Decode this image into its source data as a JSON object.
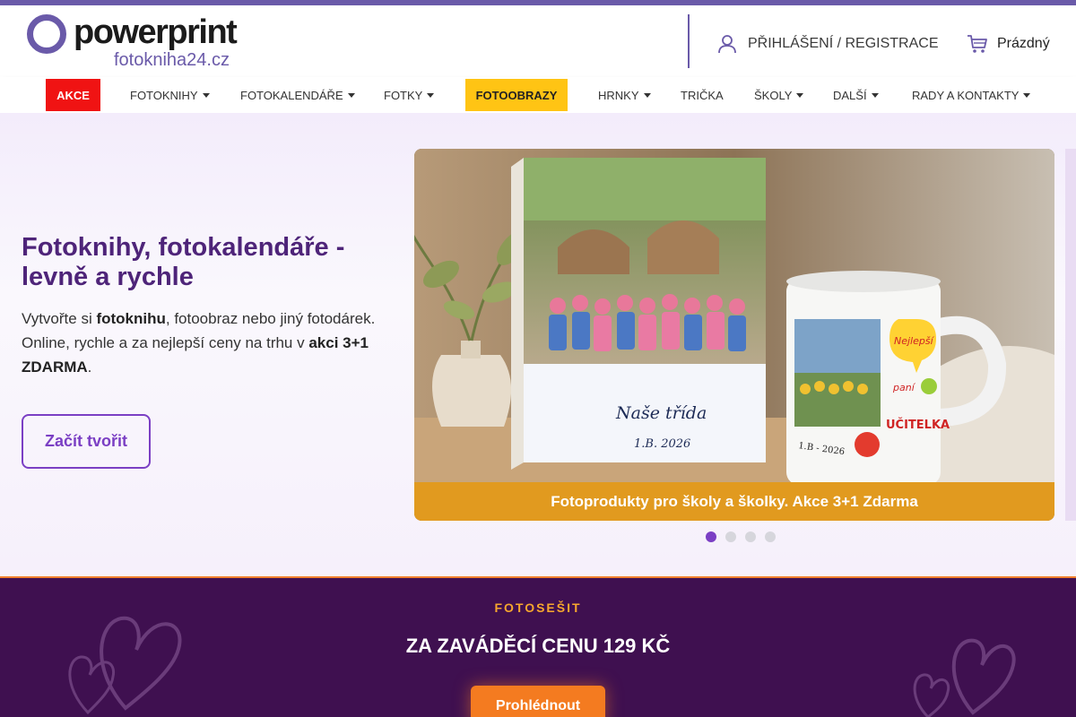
{
  "brand": {
    "name": "powerprint",
    "domain": "fotokniha24.cz",
    "accent": "#6a5aa9"
  },
  "header": {
    "login_label": "PŘIHLÁŠENÍ / REGISTRACE",
    "login_icon": "user-icon",
    "cart_label": "Prázdný",
    "cart_icon": "cart-icon"
  },
  "nav": {
    "items": [
      {
        "label": "AKCE",
        "highlight": "#f01313"
      },
      {
        "label": "FOTOKNIHY",
        "dropdown": true
      },
      {
        "label": "FOTOKALENDÁŘE",
        "dropdown": true
      },
      {
        "label": "FOTKY",
        "dropdown": true
      },
      {
        "label": "FOTOOBRAZY",
        "highlight": "#ffc414"
      },
      {
        "label": "HRNKY",
        "dropdown": true
      },
      {
        "label": "TRIČKA"
      },
      {
        "label": "ŠKOLY",
        "dropdown": true
      },
      {
        "label": "DALŠÍ",
        "dropdown": true
      },
      {
        "label": "RADY A KONTAKTY",
        "dropdown": true
      }
    ]
  },
  "hero": {
    "title": "Fotoknihy, fotokalendáře - levně a rychle",
    "text_1": "Vytvořte si ",
    "text_bold_1": "fotoknihu",
    "text_2": ", fotoobraz nebo jiný fotodárek. Online, rychle a za nejlepší ceny na trhu v ",
    "text_bold_2": "akci 3+1 ZDARMA",
    "text_3": ".",
    "cta_label": "Začít tvořit",
    "title_color": "#4e2479"
  },
  "slider": {
    "caption": "Fotoprodukty pro školy a školky. Akce 3+1 Zdarma",
    "book_text": "Naše třída",
    "book_date": "1.B. 2026",
    "mug_date": "1.B - 2026",
    "mug_bubble": "Nejlepší",
    "mug_text_1": "paní",
    "mug_text_2": "UČITELKA",
    "slide_count": 4,
    "active_index": 1,
    "caption_color": "#e19a1f"
  },
  "promo": {
    "kicker": "FOTOSEŠIT",
    "title": "ZA ZAVÁDĚCÍ CENU 129 KČ",
    "cta_label": "Prohlédnout",
    "bg_color": "#3f1050",
    "kicker_color": "#f7a72e"
  }
}
